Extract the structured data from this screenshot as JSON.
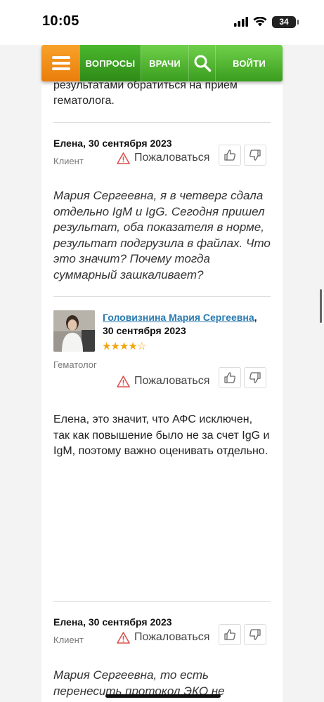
{
  "status": {
    "time": "10:05",
    "battery": "34"
  },
  "nav": {
    "menu_icon": "hamburger-icon",
    "items": [
      "ВОПРОСЫ",
      "ВРАЧИ",
      "ВОЙТИ"
    ],
    "search_icon": "search-icon"
  },
  "thread": {
    "prev_text_tail": "результатами обратиться на прием гематолога.",
    "c1": {
      "author": "Елена, 30 сентября 2023",
      "role": "Клиент",
      "report": "Пожаловаться",
      "text": "Мария Сергеевна, я в четверг сдала отдельно IgM и IgG. Сегодня пришел результат, оба показателя в норме, результат подгрузила в файлах. Что это значит? Почему тогда суммарный зашкаливает?"
    },
    "c2": {
      "doctor_name": "Головизнина Мария Сергеевна",
      "comma": ",",
      "date": "30 сентября 2023",
      "rating_stars": 4,
      "rating_max": 5,
      "role": "Гематолог",
      "report": "Пожаловаться",
      "text": "Елена, это значит, что АФС исключен, так как повышение было не за счет IgG и IgM, поэтому важно оценивать отдельно."
    },
    "c3": {
      "author": "Елена, 30 сентября 2023",
      "role": "Клиент",
      "report": "Пожаловаться",
      "text": "Мария Сергеевна, то есть перенесить протокол ЭКО не"
    }
  },
  "colors": {
    "nav_green": "#4bb72e",
    "nav_orange": "#f39415",
    "link": "#2a7ab0",
    "star": "#f3a40d"
  }
}
